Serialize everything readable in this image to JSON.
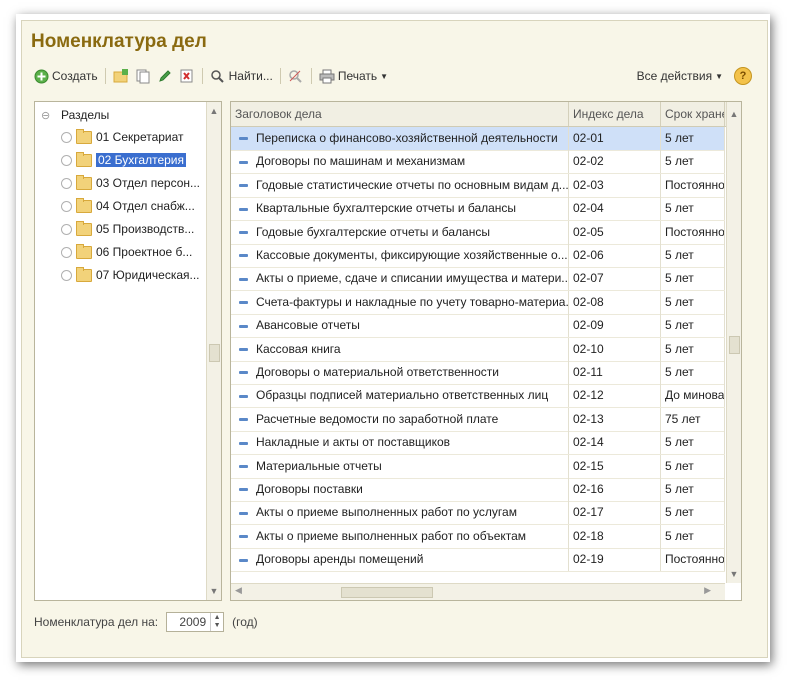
{
  "window": {
    "title": "Номенклатура дел"
  },
  "toolbar": {
    "create_label": "Создать",
    "find_label": "Найти...",
    "print_label": "Печать",
    "all_actions_label": "Все действия",
    "help_label": "?"
  },
  "tree": {
    "root_label": "Разделы",
    "items": [
      {
        "label": "01 Секретариат"
      },
      {
        "label": "02 Бухгалтерия"
      },
      {
        "label": "03 Отдел персон..."
      },
      {
        "label": "04 Отдел снабж..."
      },
      {
        "label": "05 Производств..."
      },
      {
        "label": "06 Проектное б..."
      },
      {
        "label": "07 Юридическая..."
      }
    ]
  },
  "grid": {
    "columns": [
      "Заголовок дела",
      "Индекс дела",
      "Срок хране"
    ],
    "rows": [
      {
        "title": "Переписка о финансово-хозяйственной деятельности",
        "index": "02-01",
        "term": "5 лет"
      },
      {
        "title": "Договоры по машинам и механизмам",
        "index": "02-02",
        "term": "5 лет"
      },
      {
        "title": "Годовые статистические отчеты по основным видам д...",
        "index": "02-03",
        "term": "Постоянно"
      },
      {
        "title": "Квартальные бухгалтерские отчеты и балансы",
        "index": "02-04",
        "term": "5 лет"
      },
      {
        "title": "Годовые бухгалтерские отчеты и балансы",
        "index": "02-05",
        "term": "Постоянно"
      },
      {
        "title": "Кассовые документы, фиксирующие хозяйственные о...",
        "index": "02-06",
        "term": "5 лет"
      },
      {
        "title": "Акты о приеме, сдаче и списании имущества и матери...",
        "index": "02-07",
        "term": "5 лет"
      },
      {
        "title": "Счета-фактуры и накладные по учету товарно-материа...",
        "index": "02-08",
        "term": "5 лет"
      },
      {
        "title": "Авансовые отчеты",
        "index": "02-09",
        "term": "5 лет"
      },
      {
        "title": "Кассовая книга",
        "index": "02-10",
        "term": "5 лет"
      },
      {
        "title": "Договоры о материальной ответственности",
        "index": "02-11",
        "term": "5 лет"
      },
      {
        "title": "Образцы подписей материально ответственных лиц",
        "index": "02-12",
        "term": "До минова"
      },
      {
        "title": "Расчетные ведомости по заработной плате",
        "index": "02-13",
        "term": "75 лет"
      },
      {
        "title": "Накладные и акты от поставщиков",
        "index": "02-14",
        "term": "5 лет"
      },
      {
        "title": "Материальные отчеты",
        "index": "02-15",
        "term": "5 лет"
      },
      {
        "title": "Договоры поставки",
        "index": "02-16",
        "term": "5 лет"
      },
      {
        "title": "Акты о приеме выполненных работ по услугам",
        "index": "02-17",
        "term": "5 лет"
      },
      {
        "title": "Акты о приеме выполненных работ по объектам",
        "index": "02-18",
        "term": "5 лет"
      },
      {
        "title": "Договоры аренды помещений",
        "index": "02-19",
        "term": "Постоянно"
      }
    ]
  },
  "footer": {
    "label": "Номенклатура дел на:",
    "year": "2009",
    "unit": "(год)"
  },
  "colors": {
    "title": "#8a6a10",
    "selection": "#3a6ecf",
    "row_selected": "#cfe0f8",
    "window_bg": "#f8f6e8"
  }
}
